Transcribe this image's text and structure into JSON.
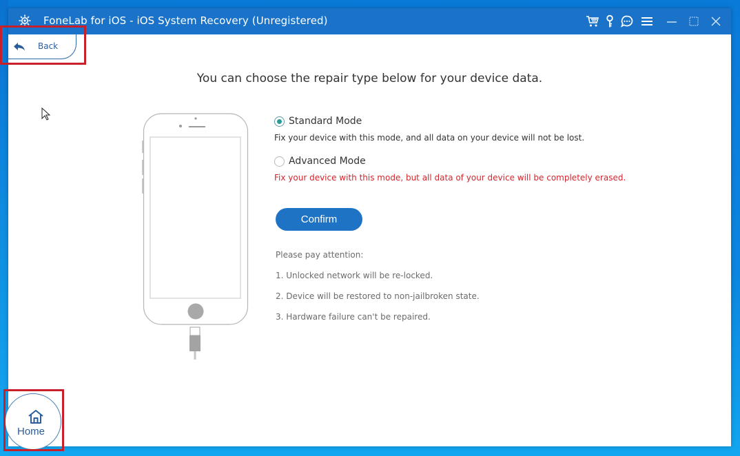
{
  "window": {
    "title": "FoneLab for iOS - iOS System Recovery (Unregistered)",
    "titlebar_color": "#1a73c8",
    "toolbar_icons": [
      "cart-icon",
      "key-icon",
      "chat-icon",
      "menu-icon"
    ],
    "window_controls": [
      "minimize",
      "maximize",
      "close"
    ]
  },
  "nav": {
    "back_label": "Back",
    "home_label": "Home"
  },
  "main": {
    "heading": "You can choose the repair type below for your device data.",
    "modes": [
      {
        "label": "Standard Mode",
        "selected": true,
        "description": "Fix your device with this mode, and all data on your device will not be lost."
      },
      {
        "label": "Advanced Mode",
        "selected": false,
        "description": "Fix your device with this mode, but all data of your device will be completely erased."
      }
    ],
    "confirm_label": "Confirm",
    "notes": {
      "title": "Please pay attention:",
      "items": [
        "1. Unlocked network will be re-locked.",
        "2. Device will be restored to non-jailbroken state.",
        "3. Hardware failure can't be repaired."
      ]
    }
  },
  "colors": {
    "accent": "#1e73c4",
    "warning": "#d4252c",
    "radio_selected": "#2a9a9a",
    "annotation": "#c8202a"
  }
}
